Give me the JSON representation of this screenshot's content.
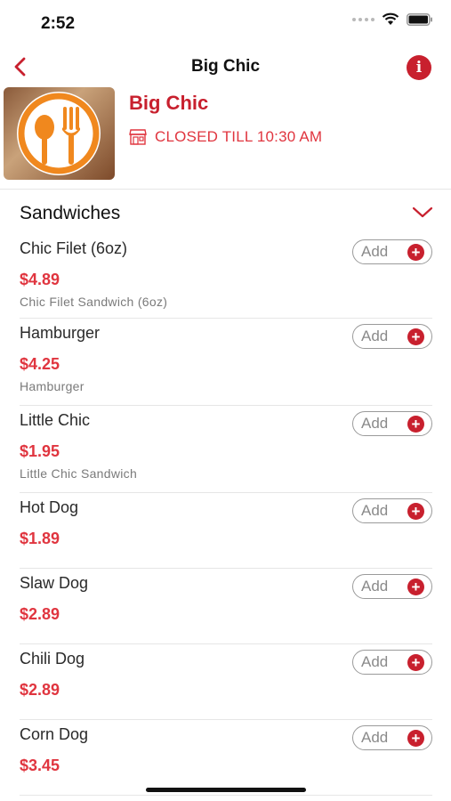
{
  "status_bar": {
    "time": "2:52"
  },
  "nav": {
    "title": "Big Chic"
  },
  "restaurant": {
    "name": "Big Chic",
    "status": "CLOSED TILL 10:30 AM"
  },
  "section": {
    "title": "Sandwiches"
  },
  "colors": {
    "brand_red": "#c8202e",
    "price_red": "#e0353f",
    "logo_orange": "#f0881e"
  },
  "icons": {
    "back": "chevron-left-icon",
    "info": "info-icon",
    "store": "store-closed-icon",
    "collapse": "chevron-down-icon",
    "add": "plus-circle-icon"
  },
  "items": [
    {
      "name": "Chic Filet (6oz)",
      "price": "$4.89",
      "desc": "Chic Filet Sandwich (6oz)",
      "add": "Add"
    },
    {
      "name": "Hamburger",
      "price": "$4.25",
      "desc": "Hamburger",
      "add": "Add"
    },
    {
      "name": "Little Chic",
      "price": "$1.95",
      "desc": "Little Chic Sandwich",
      "add": "Add"
    },
    {
      "name": "Hot Dog",
      "price": "$1.89",
      "desc": "",
      "add": "Add"
    },
    {
      "name": "Slaw Dog",
      "price": "$2.89",
      "desc": "",
      "add": "Add"
    },
    {
      "name": "Chili Dog",
      "price": "$2.89",
      "desc": "",
      "add": "Add"
    },
    {
      "name": "Corn Dog",
      "price": "$3.45",
      "desc": "",
      "add": "Add"
    }
  ]
}
